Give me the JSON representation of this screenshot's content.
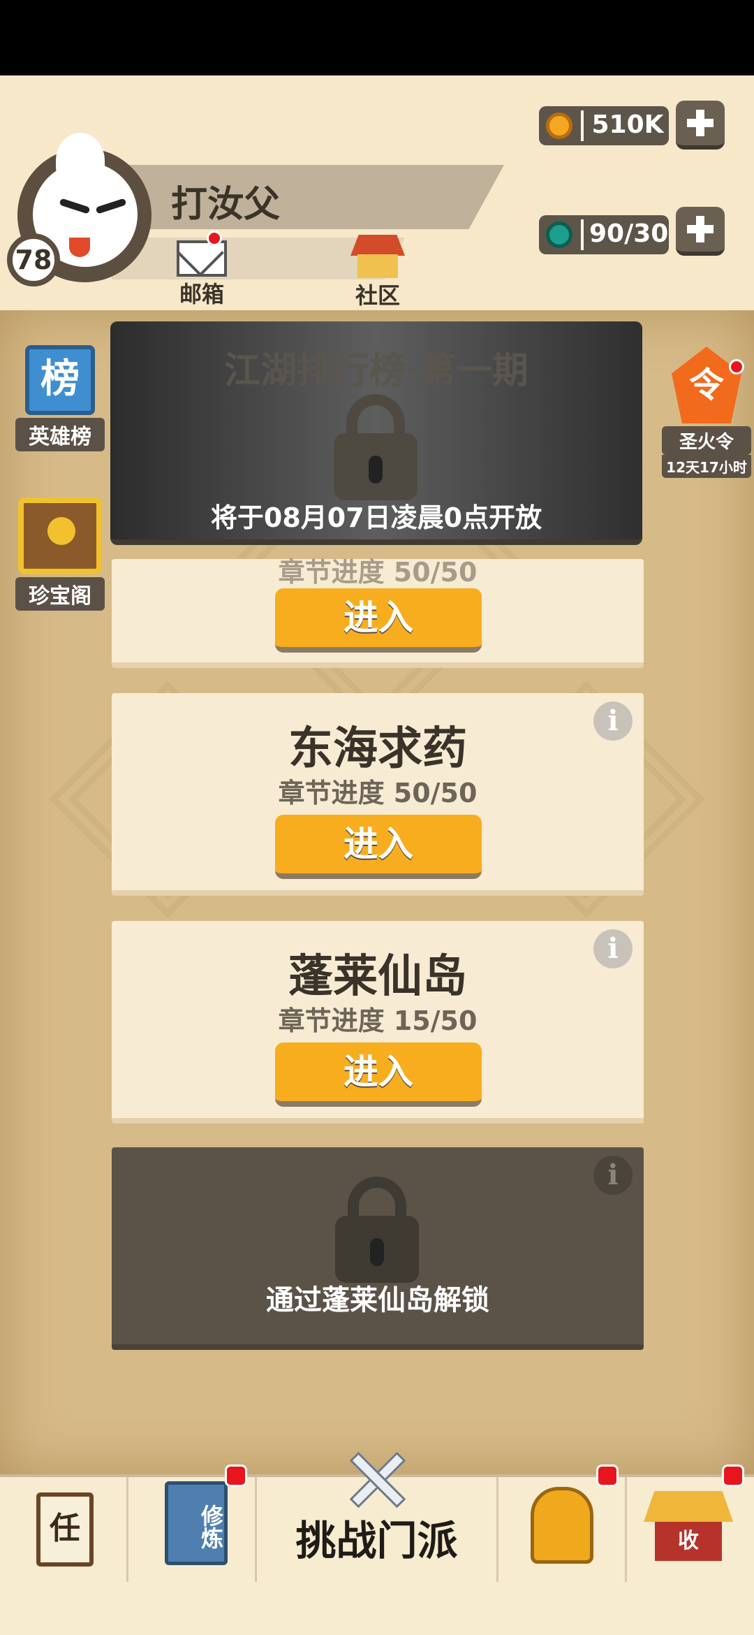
{
  "player": {
    "name": "打汝父",
    "level": "78"
  },
  "header_nav": {
    "mail_label": "邮箱",
    "community_label": "社区"
  },
  "resources": {
    "coins": "510K",
    "gems": "90/30"
  },
  "side": {
    "leaderboard_label": "英雄榜",
    "leaderboard_badge": "榜",
    "treasure_label": "珍宝阁",
    "holy_fire_label": "圣火令",
    "holy_fire_badge": "令",
    "holy_fire_timer": "12天17小时"
  },
  "banner": {
    "title": "江湖排行榜·第一期",
    "note": "将于08月07日凌晨0点开放"
  },
  "chapters": [
    {
      "title": "",
      "progress": "章节进度 50/50",
      "button": "进入"
    },
    {
      "title": "东海求药",
      "progress": "章节进度 50/50",
      "button": "进入",
      "info": "i"
    },
    {
      "title": "蓬莱仙岛",
      "progress": "章节进度 15/50",
      "button": "进入",
      "info": "i"
    }
  ],
  "locked_chapter": {
    "text": "通过蓬莱仙岛解锁",
    "info": "i"
  },
  "bottom_nav": {
    "task_badge": "任",
    "train_badge": "修炼",
    "challenge_label": "挑战门派",
    "shop_badge": "收"
  },
  "colors": {
    "accent": "#f8ad1e",
    "notification": "#e8141e"
  }
}
